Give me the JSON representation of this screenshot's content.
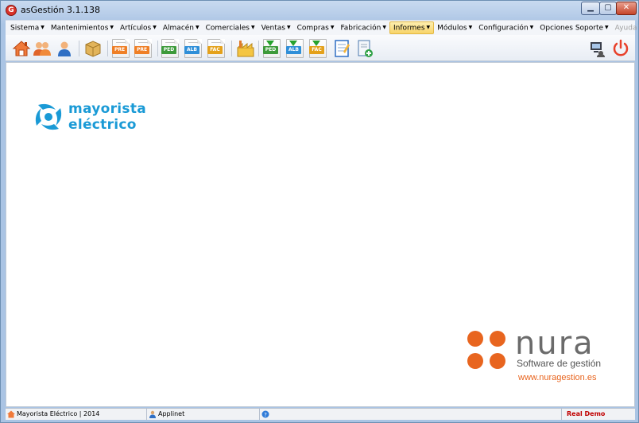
{
  "window": {
    "title": "asGestión 3.1.138",
    "app_icon_letter": "G",
    "controls": {
      "minimize": "▁",
      "maximize": "▢",
      "close": "✕"
    }
  },
  "menu": {
    "items": [
      {
        "label": "Sistema"
      },
      {
        "label": "Mantenimientos"
      },
      {
        "label": "Artículos"
      },
      {
        "label": "Almacén"
      },
      {
        "label": "Comerciales"
      },
      {
        "label": "Ventas"
      },
      {
        "label": "Compras"
      },
      {
        "label": "Fabricación"
      },
      {
        "label": "Informes",
        "active": true
      },
      {
        "label": "Módulos"
      },
      {
        "label": "Configuración"
      },
      {
        "label": "Opciones Soporte"
      },
      {
        "label": "Ayuda",
        "disabled": true
      }
    ],
    "arrow": "▼"
  },
  "toolbar": {
    "doc_tags": {
      "pre1": "PRE",
      "pre2": "PRE",
      "ped1": "PED",
      "alb1": "ALB",
      "fac1": "FAC",
      "ped2": "PED",
      "alb2": "ALB",
      "fac2": "FAC"
    }
  },
  "content": {
    "company_logo": {
      "line1": "mayorista",
      "line2": "eléctrico",
      "color": "#1a9ad6"
    },
    "vendor_logo": {
      "brand": "nura",
      "tagline": "Software de gestión",
      "url": "www.nuragestion.es",
      "accent": "#e8651f"
    }
  },
  "statusbar": {
    "company": "Mayorista Eléctrico | 2014",
    "user": "Applinet",
    "mode": "Real Demo"
  }
}
